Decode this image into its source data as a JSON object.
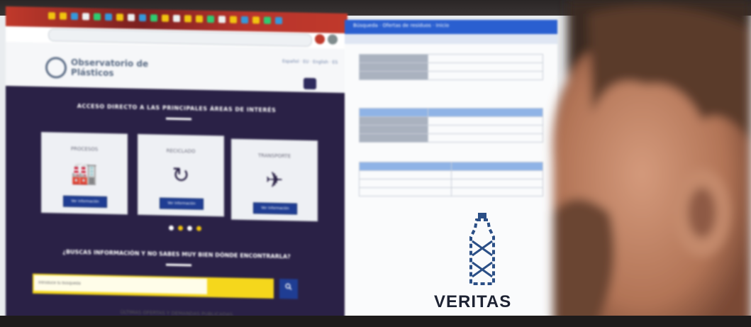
{
  "left_site": {
    "logo_text": "Observatorio de Plásticos",
    "lang_links": "Español · EU · English · ES",
    "hero_title": "ACCESO DIRECTO A LAS PRINCIPALES ÁREAS DE INTERÉS",
    "cards": [
      {
        "title": "PROCESOS",
        "icon": "factory-icon",
        "glyph": "🏭",
        "button": "Ver información"
      },
      {
        "title": "RECICLADO",
        "icon": "recycle-icon",
        "glyph": "↻",
        "button": "Ver información"
      },
      {
        "title": "TRANSPORTE",
        "icon": "airplane-icon",
        "glyph": "✈",
        "button": "Ver información"
      }
    ],
    "question": "¿BUSCAS INFORMACIÓN Y NO SABES MUY BIEN DÓNDE ENCONTRARLA?",
    "search_placeholder": "Introduce tu búsqueda",
    "search_button_icon": "search-icon",
    "footer_title": "ÚLTIMAS OFERTAS Y DEMANDAS PUBLICADAS"
  },
  "right_app": {
    "title_bar": "Búsqueda · Ofertas de residuos · Inicio",
    "veritas_label": "VERITAS"
  },
  "colors": {
    "hero_bg": "#2a2146",
    "accent_yellow": "#f5d71c",
    "button_blue": "#1f3d93",
    "browser_red": "#c0392b"
  }
}
